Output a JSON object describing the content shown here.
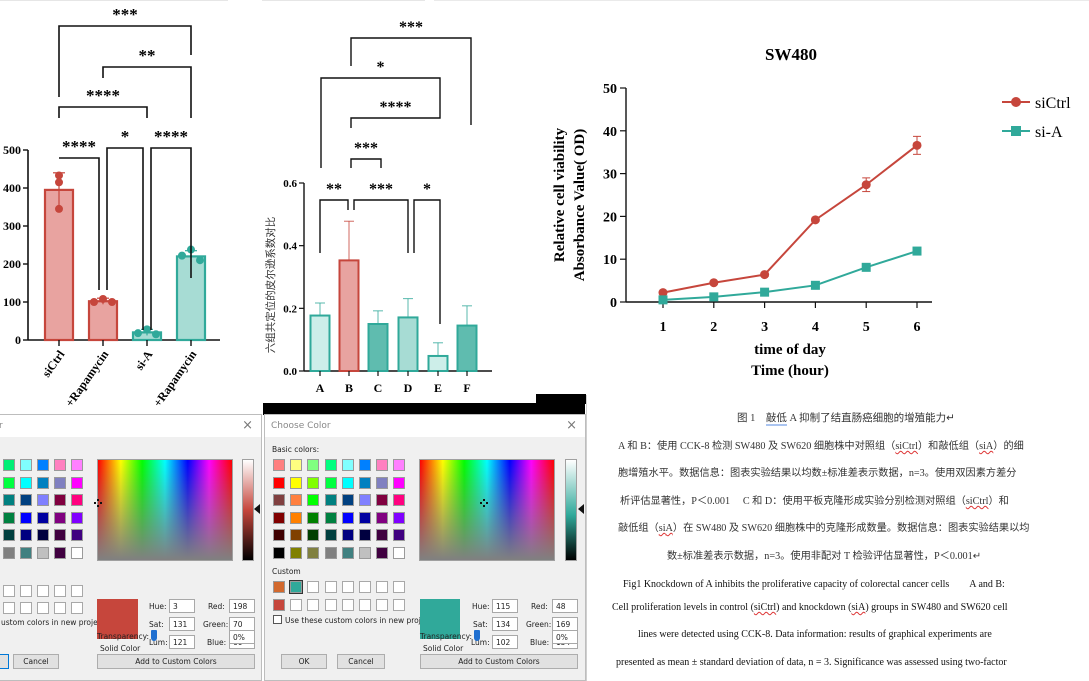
{
  "chart_data": [
    {
      "type": "bar",
      "title": "",
      "xlabel": "",
      "ylabel": "",
      "ylim": [
        0,
        500
      ],
      "yticks": [
        0,
        100,
        200,
        300,
        400,
        500
      ],
      "categories": [
        "siCtrl",
        "siCtrl+Rapamycin",
        "si-A",
        "si-A+Rapamycin"
      ],
      "visible_category_labels": [
        "siCtrl",
        "+Rapamycin",
        "si-A",
        "+Rapamycin"
      ],
      "values": [
        395,
        102,
        20,
        220
      ],
      "errors": [
        45,
        8,
        8,
        15
      ],
      "points": [
        [
          433,
          415,
          345
        ],
        [
          108,
          100,
          100
        ],
        [
          28,
          18,
          15
        ],
        [
          238,
          222,
          210
        ]
      ],
      "colors": [
        "#c6463c",
        "#c6463c",
        "#30a99a",
        "#30a99a"
      ],
      "fills": [
        "#e8a3a0",
        "#e8a3a0",
        "#a7dcd4",
        "#a7dcd4"
      ],
      "significance": [
        {
          "from": 0,
          "to": 1,
          "label": "****"
        },
        {
          "from": 1,
          "to": 2,
          "label": "*"
        },
        {
          "from": 2,
          "to": 3,
          "label": "****"
        },
        {
          "from": 0,
          "to": 2,
          "label": "****"
        },
        {
          "from": 1,
          "to": 3,
          "label": "**"
        },
        {
          "from": 0,
          "to": 3,
          "label": "***"
        }
      ]
    },
    {
      "type": "bar",
      "title": "",
      "xlabel": "",
      "ylabel": "六组共定位的皮尔逊系数对比",
      "ylim": [
        0,
        0.6
      ],
      "yticks": [
        "0.0",
        "0.2",
        "0.4",
        "0.6"
      ],
      "categories": [
        "A",
        "B",
        "C",
        "D",
        "E",
        "F"
      ],
      "values": [
        0.177,
        0.353,
        0.15,
        0.171,
        0.048,
        0.145
      ],
      "errors": [
        0.04,
        0.125,
        0.042,
        0.06,
        0.042,
        0.063
      ],
      "colors": [
        "#30a99a",
        "#c6463c",
        "#30a99a",
        "#30a99a",
        "#30a99a",
        "#30a99a"
      ],
      "fills": [
        "#cdeee9",
        "#e8a3a0",
        "#5fbcaf",
        "#a7dcd4",
        "#cdeee9",
        "#5fbcaf"
      ],
      "significance": [
        {
          "from": 0,
          "to": 1,
          "label": "**"
        },
        {
          "from": 1,
          "to": 3,
          "label": "***"
        },
        {
          "from": 3,
          "to": 4,
          "label": "*"
        },
        {
          "from": 1,
          "to": 2,
          "label": "***"
        },
        {
          "from": 1,
          "to": 4,
          "label": "****"
        },
        {
          "from": 0,
          "to": 4,
          "label": "*"
        },
        {
          "from": 1,
          "to": 5,
          "label": "***"
        }
      ]
    },
    {
      "type": "line",
      "title": "SW480",
      "xlabel": "time of day",
      "xlabel2": "Time (hour)",
      "ylabel": "Relative cell viability",
      "ylabel2": "Absorbance Value( OD)",
      "x": [
        1,
        2,
        3,
        4,
        5,
        6
      ],
      "ylim": [
        0,
        50
      ],
      "yticks": [
        0,
        10,
        20,
        30,
        40,
        50
      ],
      "legend_position": "top-right",
      "series": [
        {
          "name": "siCtrl",
          "marker": "circle",
          "color": "#c6463c",
          "values": [
            2.2,
            4.5,
            6.4,
            19.2,
            27.4,
            36.6
          ],
          "errors": [
            0.3,
            0.3,
            0.4,
            0.4,
            1.6,
            2.1
          ]
        },
        {
          "name": "si-A",
          "marker": "square",
          "color": "#30a99a",
          "values": [
            0.5,
            1.2,
            2.3,
            3.9,
            8.1,
            11.9
          ],
          "errors": [
            0.1,
            0.2,
            0.2,
            0.3,
            0.3,
            0.4
          ]
        }
      ]
    }
  ],
  "dialog_left": {
    "title": "r",
    "close_icon": "×",
    "basic_colors": [
      [
        "#00ee76",
        "#80ffff",
        "#0080ff",
        "#ff80c0",
        "#ff80ff"
      ],
      [
        "#00ff40",
        "#00ffff",
        "#0080c0",
        "#8080c0",
        "#ff00ff"
      ],
      [
        "#008080",
        "#004080",
        "#8080ff",
        "#800040",
        "#ff0080"
      ],
      [
        "#008040",
        "#0000ff",
        "#0000a0",
        "#800080",
        "#8000ff"
      ],
      [
        "#004040",
        "#000080",
        "#000040",
        "#400040",
        "#400080"
      ],
      [
        "#808080",
        "#408080",
        "#c0c0c0",
        "#400040",
        "#ffffff"
      ]
    ],
    "custom_label_partial": "ustom colors in new project",
    "solid_color_label": "Solid Color",
    "current_color": "#c6463c",
    "hue_label": "Hue:",
    "hue": "3",
    "sat_label": "Sat:",
    "sat": "131",
    "lum_label": "Lum:",
    "lum": "121",
    "red_label": "Red:",
    "red": "198",
    "green_label": "Green:",
    "green": "70",
    "blue_label": "Blue:",
    "blue": "60",
    "transparency_label": "Transparency:",
    "transparency": "0%",
    "cancel_label": "Cancel",
    "add_custom_label": "Add to Custom Colors"
  },
  "dialog_right": {
    "title": "Choose Color",
    "close_icon": "×",
    "basic_colors_label": "Basic colors:",
    "basic_colors": [
      [
        "#ff8080",
        "#ffff80",
        "#80ff80",
        "#00ff80",
        "#80ffff",
        "#0080ff",
        "#ff80c0",
        "#ff80ff"
      ],
      [
        "#ff0000",
        "#ffff00",
        "#80ff00",
        "#00ff40",
        "#00ffff",
        "#0080c0",
        "#8080c0",
        "#ff00ff"
      ],
      [
        "#804040",
        "#ff8040",
        "#00ff00",
        "#008080",
        "#004080",
        "#8080ff",
        "#800040",
        "#ff0080"
      ],
      [
        "#800000",
        "#ff8000",
        "#008000",
        "#008040",
        "#0000ff",
        "#0000a0",
        "#800080",
        "#8000ff"
      ],
      [
        "#400000",
        "#804000",
        "#004000",
        "#004040",
        "#000080",
        "#000040",
        "#400040",
        "#400080"
      ],
      [
        "#000000",
        "#808000",
        "#808040",
        "#808080",
        "#408080",
        "#c0c0c0",
        "#400040",
        "#ffffff"
      ]
    ],
    "custom_label": "Custom",
    "custom_colors": [
      "#d2692e",
      "#30a99a",
      "",
      "",
      "",
      "",
      "",
      "",
      "#c6463c",
      "",
      "",
      "",
      "",
      "",
      "",
      ""
    ],
    "use_custom_label": "Use these custom colors in new project",
    "solid_color_label": "Solid Color",
    "current_color": "#30a99a",
    "hue_label": "Hue:",
    "hue": "115",
    "sat_label": "Sat:",
    "sat": "134",
    "lum_label": "Lum:",
    "lum": "102",
    "red_label": "Red:",
    "red": "48",
    "green_label": "Green:",
    "green": "169",
    "blue_label": "Blue:",
    "blue": "154",
    "transparency_label": "Transparency:",
    "transparency": "0%",
    "ok_label": "OK",
    "cancel_label": "Cancel",
    "add_custom_label": "Add to Custom Colors"
  },
  "document": {
    "caption_cn": "图 1　敲低 A 抑制了结直肠癌细胞的增殖能力↵",
    "caption_cn_marked": "敲低",
    "lines_cn": [
      "A 和 B：使用 CCK-8 检测 SW480 及 SW620 细胞株中对照组（siCtrl）和敲低组（siA）的细",
      "胞增殖水平。数据信息：图表实验结果以均数±标准差表示数据，n=3。使用双因素方差分",
      "析评估显著性，P＜0.001　 C 和 D：使用平板克隆形成实验分别检测对照组（siCtrl）和",
      "敲低组（siA）在 SW480 及 SW620 细胞株中的克隆形成数量。数据信息：图表实验结果以均",
      "数±标准差表示数据，n=3。使用非配对 T 检验评估显著性，P＜0.001↵"
    ],
    "lines_en": [
      "Fig1 Knockdown of A inhibits the proliferative capacity of colorectal cancer cells　　A and B:",
      "Cell proliferation levels in control (siCtrl) and knockdown (siA) groups in SW480 and SW620 cell",
      "lines were detected using CCK-8.  Data information: results of graphical experiments are",
      "presented as mean ± standard deviation of data, n = 3. Significance was assessed using two-factor"
    ]
  }
}
